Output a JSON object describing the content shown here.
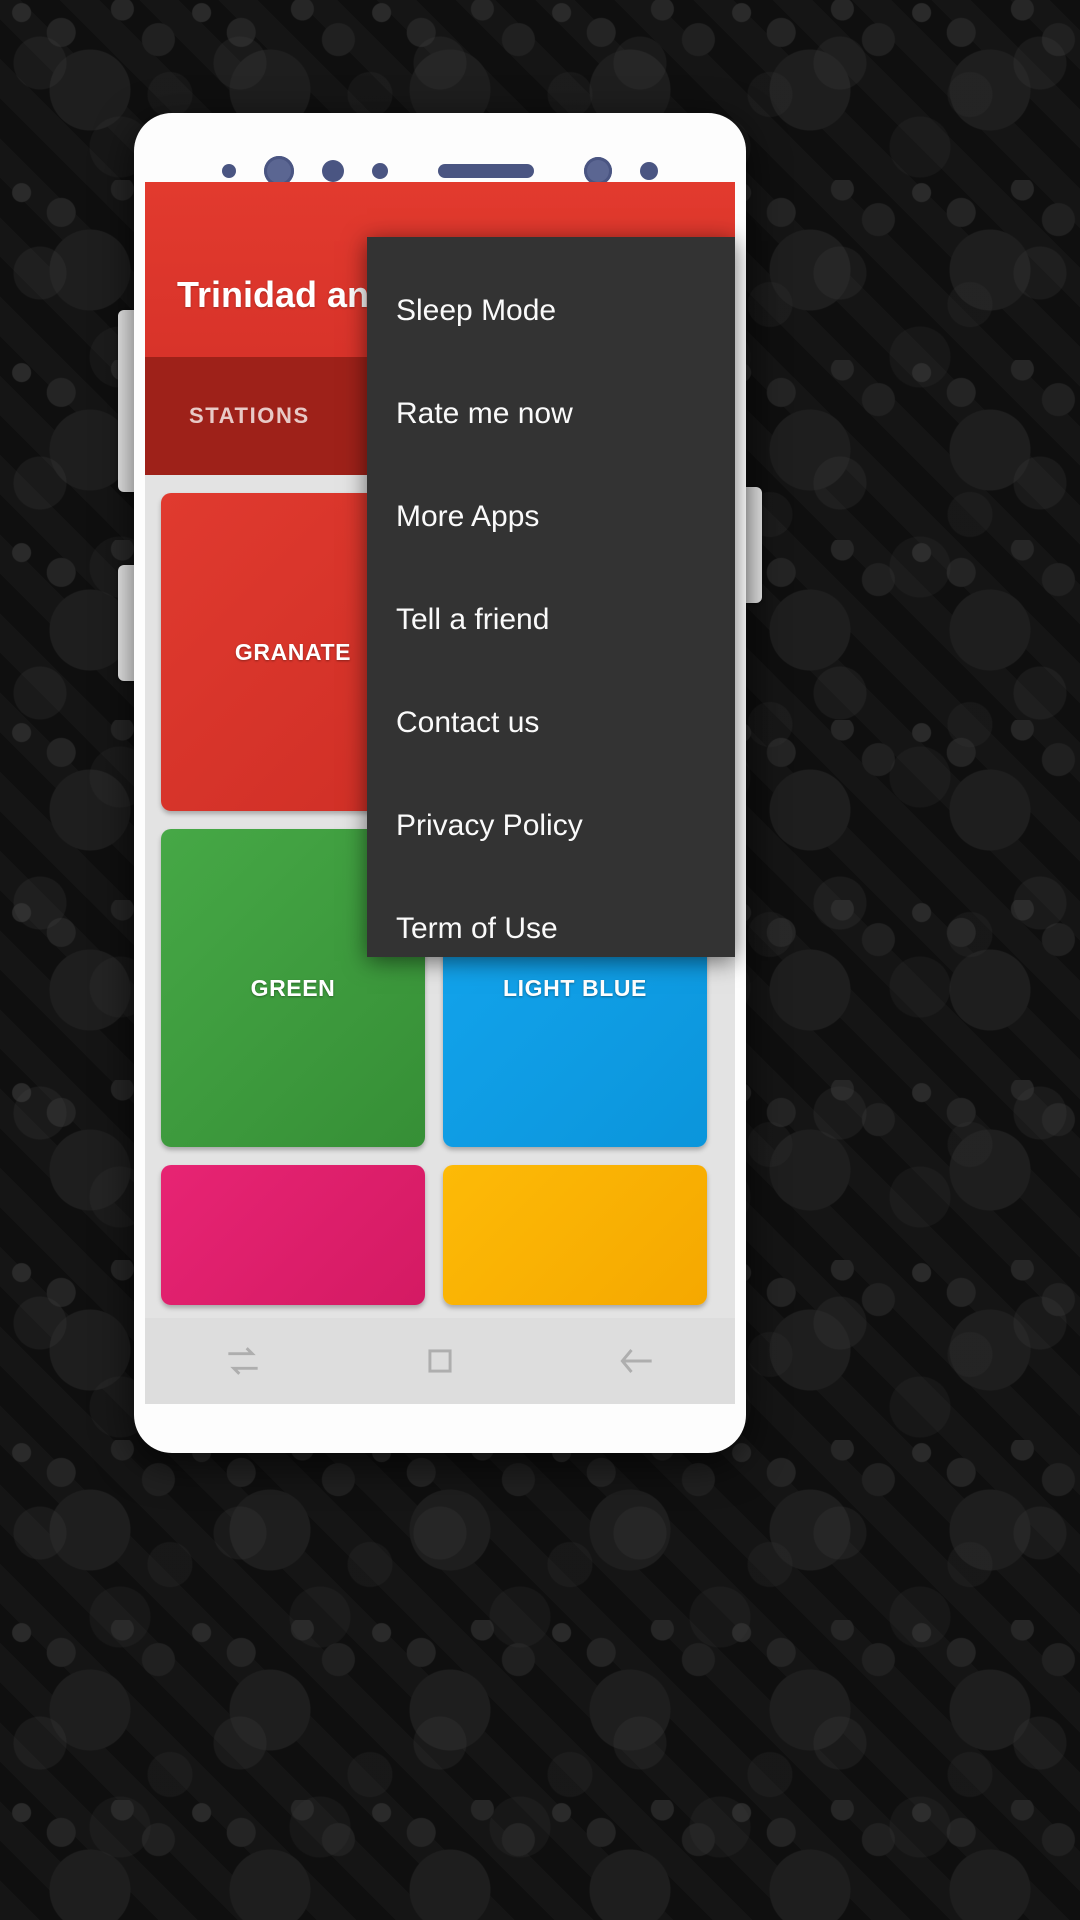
{
  "device": {
    "sensors": [
      "proximity-dot",
      "front-camera",
      "sensor-dot",
      "led-dot",
      "earpiece-speaker",
      "sensor-dot-right",
      "light-sensor-dot"
    ]
  },
  "app": {
    "title": "Trinidad and",
    "appbar_color": "#e0362c",
    "tabbar_color": "#9e2119",
    "tabs": [
      {
        "label": "STATIONS",
        "active": true
      }
    ],
    "tiles": [
      {
        "label": "GRANATE",
        "color": "#d8342b",
        "shape": "tall",
        "has_slash_icon": true
      },
      {
        "label": "",
        "color": "#d8342b",
        "shape": "tall",
        "has_slash_icon": false
      },
      {
        "label": "GREEN",
        "color": "#3d9e3d",
        "shape": "tall",
        "has_slash_icon": false
      },
      {
        "label": "LIGHT BLUE",
        "color": "#0d9ee8",
        "shape": "tall",
        "has_slash_icon": false
      },
      {
        "label": "",
        "color": "#e01e6b",
        "shape": "short",
        "has_slash_icon": false
      },
      {
        "label": "",
        "color": "#fbb201",
        "shape": "short",
        "has_slash_icon": false
      }
    ]
  },
  "menu": {
    "background": "#333333",
    "items": [
      {
        "label": "Sleep Mode"
      },
      {
        "label": "Rate me now"
      },
      {
        "label": "More Apps"
      },
      {
        "label": "Tell a friend"
      },
      {
        "label": "Contact us"
      },
      {
        "label": "Privacy Policy"
      },
      {
        "label": "Term of Use"
      }
    ]
  },
  "navbar": {
    "buttons": [
      {
        "name": "recents-icon"
      },
      {
        "name": "home-icon"
      },
      {
        "name": "back-icon"
      }
    ]
  }
}
